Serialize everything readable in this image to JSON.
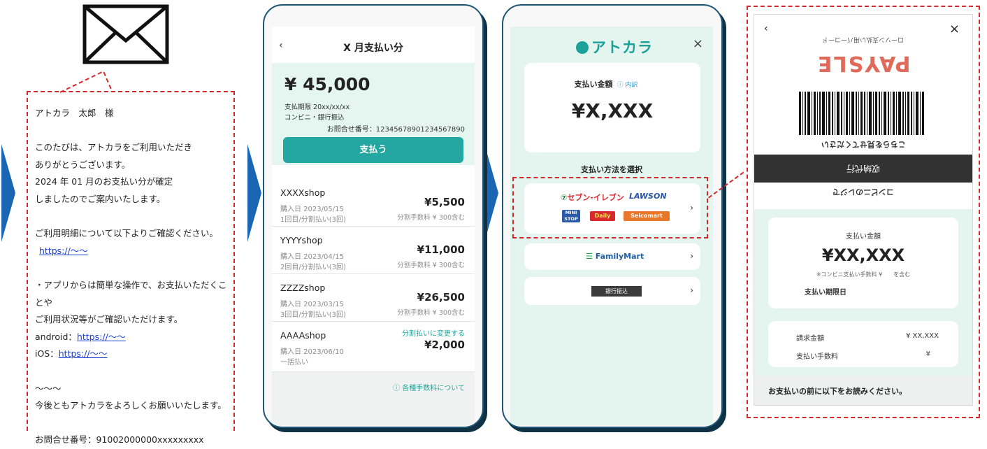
{
  "email": {
    "lines": [
      "アトカラ　太郎　様",
      "",
      "このたびは、アトカラをご利用いただき",
      "ありがとうございます。",
      "2024 年 01 月のお支払い分が確定",
      "しましたのでご案内いたします。",
      "",
      "ご利用明細について以下よりご確認ください。",
      "",
      "",
      "・アプリからは簡単な操作で、お支払いただくことや",
      "ご利用状況等がご確認いただけます。",
      "",
      "",
      "",
      "〜〜〜",
      "今後ともアトカラをよろしくお願いいたします。",
      "",
      "お問合せ番号：91002000000xxxxxxxxx"
    ],
    "detail_link": "https://〜〜",
    "android_label": "android：",
    "android_link": "https://〜〜",
    "ios_label": "iOS：",
    "ios_link": "https://〜〜"
  },
  "screen1": {
    "back": "‹",
    "title": "X 月支払い分",
    "amount": "¥ 45,000",
    "due": "支払期限  20xx/xx/xx",
    "method": "コンビニ・銀行振込",
    "inquiry": "お問合せ番号：12345678901234567890",
    "pay_button": "支払う",
    "shops": [
      {
        "name": "XXXXshop",
        "date": "購入日  2023/05/15",
        "plan": "1回目/分割払い(3回)",
        "price": "¥5,500",
        "fee": "分割手数料 ¥ 300含む",
        "change": ""
      },
      {
        "name": "YYYYshop",
        "date": "購入日  2023/04/15",
        "plan": "2回目/分割払い(3回)",
        "price": "¥11,000",
        "fee": "分割手数料 ¥ 300含む",
        "change": ""
      },
      {
        "name": "ZZZZshop",
        "date": "購入日  2023/03/15",
        "plan": "3回目/分割払い(3回)",
        "price": "¥26,500",
        "fee": "分割手数料 ¥ 300含む",
        "change": ""
      },
      {
        "name": "AAAAshop",
        "date": "購入日  2023/06/10",
        "plan": "一括払い",
        "price": "¥2,000",
        "fee": "",
        "change": "分割払いに変更する"
      }
    ],
    "fees_link": "ⓘ 各種手数料について"
  },
  "screen2": {
    "logo": "アトカラ",
    "close": "×",
    "amount_label": "支払い金額",
    "amount_info": "ⓘ 内訳",
    "amount": "¥X,XXX",
    "select_label": "支払い方法を選択",
    "stores": {
      "seven": "セブン-イレブン",
      "lawson": "LAWSON",
      "ministop": "MINI STOP",
      "daily": "Daily",
      "seicomart": "Seicomart",
      "familymart": "FamilyMart",
      "bank": "銀行振込"
    },
    "chevron": "›"
  },
  "screen3": {
    "back": "‹",
    "close": "×",
    "mirror_top": "ローソン支払い用バーコード",
    "mirror_brand": "PAYSLE",
    "mirror_caption": "こちらを見せてください",
    "mirror_band": "収納代行",
    "mirror_bottom": "コンビニのレジで",
    "amount_label": "支払い金額",
    "amount": "¥XX,XXX",
    "fee_note": "※コンビニ支払い手数料 ¥　　を含む",
    "due_label": "支払い期限日",
    "billing_label": "請求金額",
    "billing_value": "¥ XX,XXX",
    "fee_label": "支払い手数料",
    "fee_value": "¥",
    "notice": "お支払いの前に以下をお読みください。"
  },
  "colors": {
    "accent_teal": "#24a7a0",
    "arrow_blue": "#1b65b5",
    "dash_red": "#d4282c",
    "mint": "#e3f5ee"
  }
}
